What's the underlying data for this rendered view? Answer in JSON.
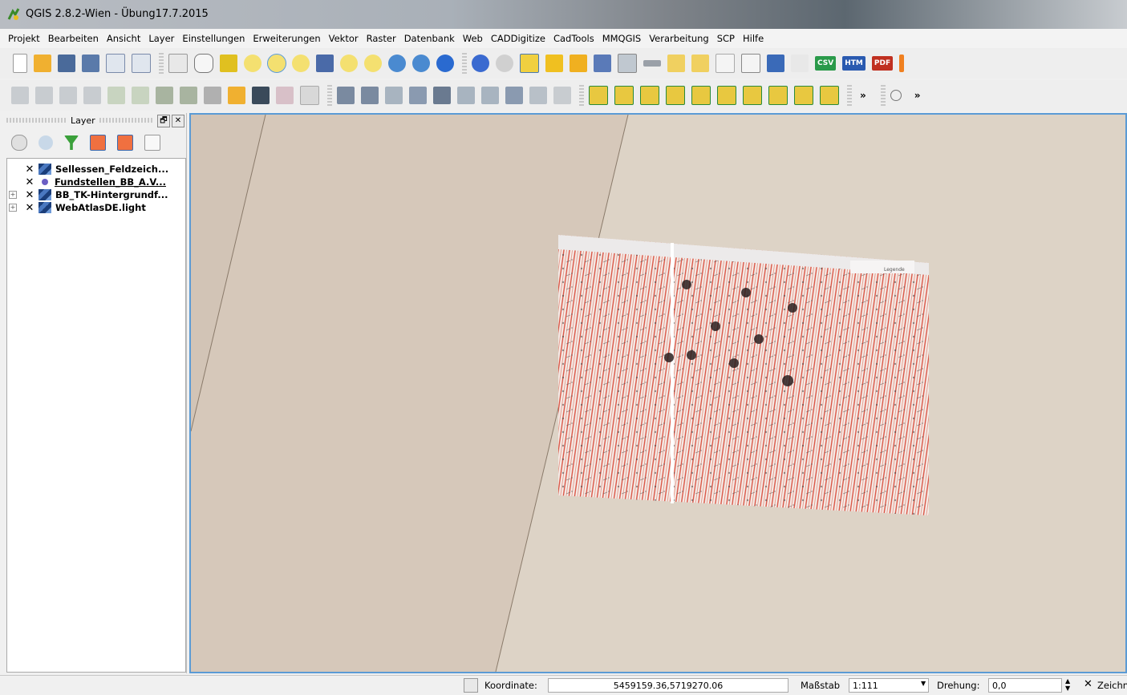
{
  "window": {
    "title": "QGIS 2.8.2-Wien - Übung17.7.2015"
  },
  "menu": [
    "Projekt",
    "Bearbeiten",
    "Ansicht",
    "Layer",
    "Einstellungen",
    "Erweiterungen",
    "Vektor",
    "Raster",
    "Datenbank",
    "Web",
    "CADDigitize",
    "CadTools",
    "MMQGIS",
    "Verarbeitung",
    "SCP",
    "Hilfe"
  ],
  "toolbar": {
    "csv_label": "CSV",
    "htm_label": "HTM",
    "pdf_label": "PDF",
    "overflow_label": "»"
  },
  "colors": {
    "accent": "#5b9bd5",
    "canvas_bg": "#ddd3c6",
    "raster_red": "#d9503f",
    "vector_point": "#6c5fc4"
  },
  "layers_panel": {
    "title": "Layer",
    "float_button": "🗗",
    "close_button": "✕",
    "layers": [
      {
        "name": "Sellessen_Feldzeich...",
        "checked": "✕",
        "type": "raster",
        "expandable": false
      },
      {
        "name": "Fundstellen_BB_A.V...",
        "checked": "✕",
        "type": "point",
        "expandable": false
      },
      {
        "name": "BB_TK-Hintergrundf...",
        "checked": "✕",
        "type": "raster",
        "expandable": true
      },
      {
        "name": "WebAtlasDE.light",
        "checked": "✕",
        "type": "raster",
        "expandable": true
      }
    ]
  },
  "map": {
    "scan_label": "Legende"
  },
  "status": {
    "coord_label": "Koordinate:",
    "coord_value": "5459159.36,5719270.06",
    "scale_label": "Maßstab",
    "scale_value": "1:111",
    "rotation_label": "Drehung:",
    "rotation_value": "0,0",
    "render_label": "Zeichnen"
  }
}
